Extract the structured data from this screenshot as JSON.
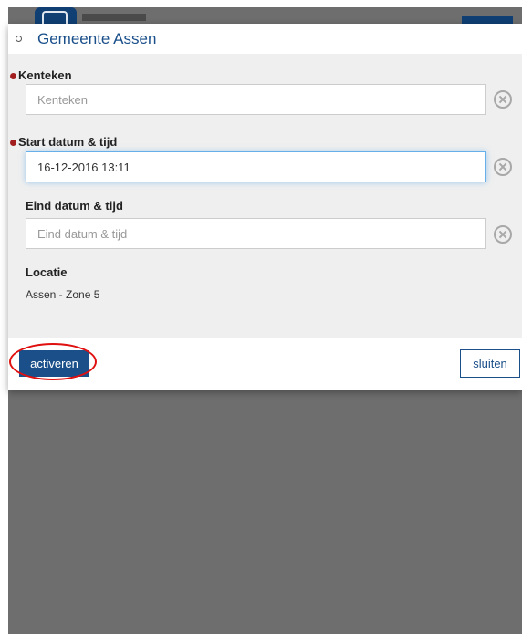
{
  "header": {
    "title": "Gemeente Assen",
    "icon": "location-dot-icon"
  },
  "form": {
    "kenteken": {
      "label": "Kenteken",
      "placeholder": "Kenteken",
      "value": "",
      "required": true
    },
    "start": {
      "label": "Start datum & tijd",
      "placeholder": "Start datum & tijd",
      "value": "16-12-2016 13:11",
      "required": true
    },
    "eind": {
      "label": "Eind datum & tijd",
      "placeholder": "Eind datum & tijd",
      "value": "",
      "required": false
    },
    "locatie": {
      "label": "Locatie",
      "value": "Assen - Zone 5"
    }
  },
  "footer": {
    "activate_label": "activeren",
    "close_label": "sluiten"
  },
  "colors": {
    "accent": "#1a4f8a",
    "required": "#a31f1f",
    "highlight": "#e01010",
    "backdrop": "#6e6e6e",
    "panel": "#efefef"
  }
}
